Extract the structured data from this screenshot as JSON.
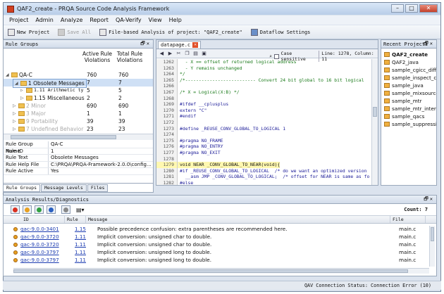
{
  "window": {
    "title": "QAF2_create - PRQA Source Code Analysis Framework"
  },
  "menu": [
    "Project",
    "Admin",
    "Analyze",
    "Report",
    "QA-Verify",
    "View",
    "Help"
  ],
  "toolbar": {
    "new_project": "New Project",
    "save_all": "Save All",
    "file_based": "File-based Analysis of project: \"QAF2_create\"",
    "dataflow": "Dataflow Settings"
  },
  "rule_groups": {
    "title": "Rule Groups",
    "col1": "Active Rule Violations",
    "col2": "Total Rule Violations",
    "rows": [
      {
        "name": "QA-C",
        "active": "760",
        "total": "760"
      },
      {
        "name": "1 Obsolete Messages",
        "active": "7",
        "total": "7"
      },
      {
        "name": "1.11 Arithmetic ty",
        "active": "5",
        "total": "5"
      },
      {
        "name": "1.15 Miscellaneous",
        "active": "2",
        "total": "2"
      },
      {
        "name": "2 Minor",
        "active": "690",
        "total": "690"
      },
      {
        "name": "3 Major",
        "active": "1",
        "total": "1"
      },
      {
        "name": "9 Portability",
        "active": "39",
        "total": "39"
      },
      {
        "name": "7 Undefined Behavior",
        "active": "23",
        "total": "23"
      }
    ]
  },
  "properties": [
    {
      "key": "Rule Group Name",
      "value": "QA-C"
    },
    {
      "key": "Rule ID",
      "value": "1"
    },
    {
      "key": "Rule Text",
      "value": "Obsolete Messages"
    },
    {
      "key": "Rule Help File",
      "value": "C:\\PRQA\\PRQA-Framework-2.0.0\\config..."
    },
    {
      "key": "Rule Active",
      "value": "Yes"
    }
  ],
  "left_tabs": [
    "Rule Groups",
    "Message Levels",
    "Files"
  ],
  "editor": {
    "tab": "datapage.c",
    "find_label": "Case sensitive",
    "position": "Line: 1278, Column: 11",
    "lines": [
      {
        "n": "1262",
        "t": "  - X == offset of returned logical address",
        "k": "c"
      },
      {
        "n": "1263",
        "t": "  - Y remains unchanged",
        "k": "c"
      },
      {
        "n": "1264",
        "t": "*/",
        "k": "c"
      },
      {
        "n": "1265",
        "t": "/*-------------------------- Convert 24 bit global to 16 bit logical",
        "k": "c"
      },
      {
        "n": "1266",
        "t": "",
        "k": "c"
      },
      {
        "n": "1267",
        "t": "/* X = Logical(X:B) */",
        "k": "c"
      },
      {
        "n": "1268",
        "t": "",
        "k": "c"
      },
      {
        "n": "1269",
        "t": "#ifdef __cplusplus",
        "k": "p"
      },
      {
        "n": "1270",
        "t": "extern \"C\"",
        "k": "p"
      },
      {
        "n": "1271",
        "t": "#endif",
        "k": "p"
      },
      {
        "n": "1272",
        "t": "",
        "k": "p"
      },
      {
        "n": "1273",
        "t": "#define _REUSE_CONV_GLOBAL_TO_LOGICAL 1",
        "k": "p"
      },
      {
        "n": "1274",
        "t": "",
        "k": "p"
      },
      {
        "n": "1275",
        "t": "#pragma NO_FRAME",
        "k": "p"
      },
      {
        "n": "1276",
        "t": "#pragma NO_ENTRY",
        "k": "p"
      },
      {
        "n": "1277",
        "t": "#pragma NO_EXIT",
        "k": "p"
      },
      {
        "n": "1278",
        "t": "",
        "k": "p"
      },
      {
        "n": "1279",
        "t": "void NEAR _CONV_GLOBAL_TO_NEAR(void){",
        "k": "h"
      },
      {
        "n": "1280",
        "t": "#if _REUSE_CONV_GLOBAL_TO_LOGICAL  /* do we want an optimized version",
        "k": "p"
      },
      {
        "n": "1281",
        "t": "  __asm JMP _CONV_GLOBAL_TO_LOGICAL;  /* offset for NEAR is same as fo",
        "k": "p"
      },
      {
        "n": "1282",
        "t": "#else",
        "k": "p"
      }
    ]
  },
  "recent_projects": {
    "title": "Recent Projects",
    "items": [
      "QAF2_create",
      "QAF2_java",
      "sample_cgicc_diff",
      "sample_inspect_c",
      "sample_java",
      "sample_mixsource",
      "sample_mtr",
      "sample_mtr_intern",
      "sample_qacs",
      "sample_suppressio"
    ]
  },
  "analysis": {
    "title": "Analysis Results/Diagnostics",
    "count": "Count: 7",
    "headers": {
      "id": "ID",
      "rule": "Rule",
      "message": "Message",
      "file": "File"
    },
    "rows": [
      {
        "id": "qac-9.0.0-3401",
        "rule": "1.15",
        "message": "Possible precedence confusion: extra parentheses are recommended here.",
        "file": "main.c"
      },
      {
        "id": "qac-9.0.0-3720",
        "rule": "1.11",
        "message": "Implicit conversion: unsigned char to double.",
        "file": "main.c"
      },
      {
        "id": "qac-9.0.0-3720",
        "rule": "1.11",
        "message": "Implicit conversion: unsigned char to double.",
        "file": "main.c"
      },
      {
        "id": "qac-9.0.0-3797",
        "rule": "1.11",
        "message": "Implicit conversion: unsigned long to double.",
        "file": "main.c"
      },
      {
        "id": "qac-9.0.0-3797",
        "rule": "1.11",
        "message": "Implicit conversion: unsigned long to double.",
        "file": "main.c"
      }
    ]
  },
  "status": {
    "text": "QAV Connection Status: Connection Error (10)"
  }
}
